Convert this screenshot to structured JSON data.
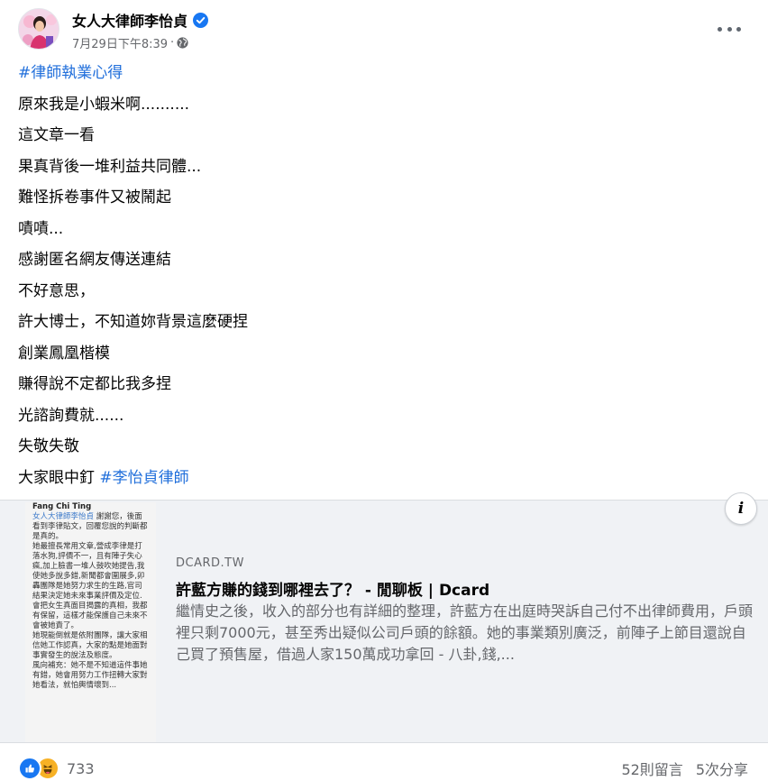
{
  "post": {
    "author": "女人大律師李怡貞",
    "timestamp": "7月29日下午8:39",
    "privacy_separator": "·",
    "lines": [
      {
        "text": "#律師執業心得",
        "tag": "#律師執業心得"
      },
      {
        "text": "原來我是小蝦米啊.........."
      },
      {
        "text": "這文章一看"
      },
      {
        "text": "果真背後一堆利益共同體..."
      },
      {
        "text": "難怪拆卷事件又被鬧起"
      },
      {
        "text": "嘖嘖..."
      },
      {
        "text": "感謝匿名網友傳送連結"
      },
      {
        "text": "不好意思，"
      },
      {
        "text": "許大博士，不知道妳背景這麼硬捏"
      },
      {
        "text": "創業鳳凰楷模"
      },
      {
        "text": "賺得說不定都比我多捏"
      },
      {
        "text": "光諮詢費就......"
      },
      {
        "text": "失敬失敬"
      },
      {
        "text": "大家眼中釘 ",
        "tag": "#李怡貞律師"
      }
    ]
  },
  "link_preview": {
    "domain": "DCARD.TW",
    "title": "許藍方賺的錢到哪裡去了？ - 閒聊板 | Dcard",
    "description": "繼情史之後，收入的部分也有詳細的整理，許藍方在出庭時哭訴自己付不出律師費用，戶頭裡只剩7000元，甚至秀出疑似公司戶頭的餘額。她的事業類別廣泛，前陣子上節目還說自己買了預售屋，借過人家150萬成功拿回 - 八卦,錢,...",
    "info_label": "i",
    "thumbnail": {
      "commenter": "Fang Chi Ting",
      "mention": "女人大律師李怡貞",
      "text": " 謝謝您，後面看到李律貼文，回覆您說的判斷都是真的。\n她最擅長常用文章,營成李律是打落水狗,評價不一，且有陣子失心瘋,加上臉書一堆人鼓吹她提告,我使她多說多錯,新聞都會圍展多,卯轟團隊是她努力求生的生路,官司結果決定她未來事業評價及定位.\n會把女生真面目揭露的真相，我都有保留，這樣才能保護自己未來不會被她責了。\n她現能倒就是依附團隊，讓大家相信她工作認真，大家的點是她面對事實發生的說法及態度。\n風向補充：她不是不知道這件事她有錯，她會用努力工作扭轉大家對她看法，就怕輿情壞到..."
    }
  },
  "footer": {
    "reaction_count": "733",
    "comments": "52則留言",
    "shares": "5次分享"
  },
  "colors": {
    "link_blue": "#216fdb",
    "like_blue": "#1877f2",
    "haha_yellow": "#f7b125",
    "secondary_text": "#65676b",
    "preview_bg": "#f0f2f5"
  },
  "icons": [
    "verified-badge-icon",
    "globe-icon",
    "more-options-icon",
    "info-icon",
    "like-reaction-icon",
    "haha-reaction-icon"
  ]
}
